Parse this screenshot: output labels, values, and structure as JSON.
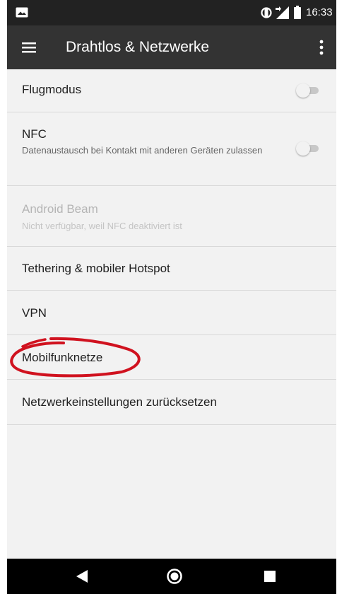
{
  "status_bar": {
    "time": "16:33",
    "icons": [
      "gallery-notification-icon",
      "screen-rotation-icon",
      "signal-icon",
      "battery-icon"
    ]
  },
  "app_bar": {
    "title": "Drahtlos & Netzwerke",
    "menu_icon": "hamburger-menu-icon",
    "overflow_icon": "more-vert-icon"
  },
  "settings": [
    {
      "label": "Flugmodus",
      "summary": "",
      "toggle": "off",
      "enabled": true
    },
    {
      "label": "NFC",
      "summary": "Datenaustausch bei Kontakt mit anderen Geräten zulassen",
      "toggle": "off",
      "enabled": true
    },
    {
      "label": "Android Beam",
      "summary": "Nicht verfügbar, weil NFC deaktiviert ist",
      "enabled": false
    },
    {
      "label": "Tethering & mobiler Hotspot",
      "enabled": true
    },
    {
      "label": "VPN",
      "enabled": true
    },
    {
      "label": "Mobilfunknetze",
      "enabled": true,
      "highlighted": true
    },
    {
      "label": "Netzwerkeinstellungen zurücksetzen",
      "enabled": true
    }
  ],
  "annotation": {
    "type": "hand-drawn-circle",
    "color": "#d0121f",
    "target": "Mobilfunknetze"
  },
  "nav_bar": {
    "icons": [
      "back-icon",
      "home-icon",
      "recents-icon"
    ]
  },
  "colors": {
    "status_bar": "#222222",
    "app_bar": "#333333",
    "background": "#f2f2f2",
    "divider": "#d9d9d9",
    "marker": "#d0121f"
  }
}
